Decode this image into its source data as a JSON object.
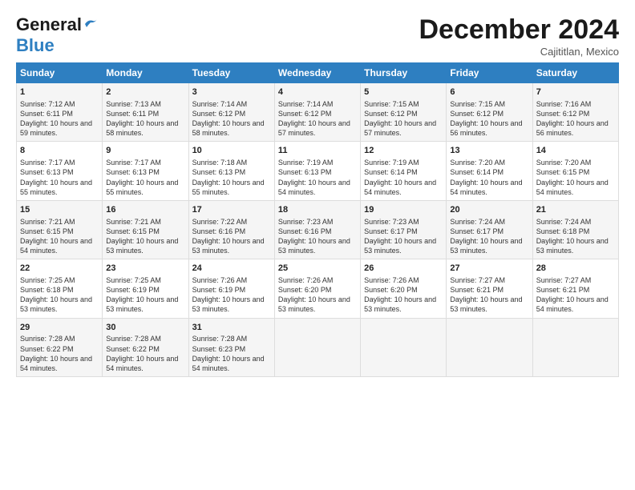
{
  "logo": {
    "part1": "General",
    "part2": "Blue"
  },
  "title": "December 2024",
  "subtitle": "Cajititlan, Mexico",
  "days_of_week": [
    "Sunday",
    "Monday",
    "Tuesday",
    "Wednesday",
    "Thursday",
    "Friday",
    "Saturday"
  ],
  "weeks": [
    [
      {
        "day": "1",
        "sunrise": "7:12 AM",
        "sunset": "6:11 PM",
        "daylight": "10 hours and 59 minutes."
      },
      {
        "day": "2",
        "sunrise": "7:13 AM",
        "sunset": "6:11 PM",
        "daylight": "10 hours and 58 minutes."
      },
      {
        "day": "3",
        "sunrise": "7:14 AM",
        "sunset": "6:12 PM",
        "daylight": "10 hours and 58 minutes."
      },
      {
        "day": "4",
        "sunrise": "7:14 AM",
        "sunset": "6:12 PM",
        "daylight": "10 hours and 57 minutes."
      },
      {
        "day": "5",
        "sunrise": "7:15 AM",
        "sunset": "6:12 PM",
        "daylight": "10 hours and 57 minutes."
      },
      {
        "day": "6",
        "sunrise": "7:15 AM",
        "sunset": "6:12 PM",
        "daylight": "10 hours and 56 minutes."
      },
      {
        "day": "7",
        "sunrise": "7:16 AM",
        "sunset": "6:12 PM",
        "daylight": "10 hours and 56 minutes."
      }
    ],
    [
      {
        "day": "8",
        "sunrise": "7:17 AM",
        "sunset": "6:13 PM",
        "daylight": "10 hours and 55 minutes."
      },
      {
        "day": "9",
        "sunrise": "7:17 AM",
        "sunset": "6:13 PM",
        "daylight": "10 hours and 55 minutes."
      },
      {
        "day": "10",
        "sunrise": "7:18 AM",
        "sunset": "6:13 PM",
        "daylight": "10 hours and 55 minutes."
      },
      {
        "day": "11",
        "sunrise": "7:19 AM",
        "sunset": "6:13 PM",
        "daylight": "10 hours and 54 minutes."
      },
      {
        "day": "12",
        "sunrise": "7:19 AM",
        "sunset": "6:14 PM",
        "daylight": "10 hours and 54 minutes."
      },
      {
        "day": "13",
        "sunrise": "7:20 AM",
        "sunset": "6:14 PM",
        "daylight": "10 hours and 54 minutes."
      },
      {
        "day": "14",
        "sunrise": "7:20 AM",
        "sunset": "6:15 PM",
        "daylight": "10 hours and 54 minutes."
      }
    ],
    [
      {
        "day": "15",
        "sunrise": "7:21 AM",
        "sunset": "6:15 PM",
        "daylight": "10 hours and 54 minutes."
      },
      {
        "day": "16",
        "sunrise": "7:21 AM",
        "sunset": "6:15 PM",
        "daylight": "10 hours and 53 minutes."
      },
      {
        "day": "17",
        "sunrise": "7:22 AM",
        "sunset": "6:16 PM",
        "daylight": "10 hours and 53 minutes."
      },
      {
        "day": "18",
        "sunrise": "7:23 AM",
        "sunset": "6:16 PM",
        "daylight": "10 hours and 53 minutes."
      },
      {
        "day": "19",
        "sunrise": "7:23 AM",
        "sunset": "6:17 PM",
        "daylight": "10 hours and 53 minutes."
      },
      {
        "day": "20",
        "sunrise": "7:24 AM",
        "sunset": "6:17 PM",
        "daylight": "10 hours and 53 minutes."
      },
      {
        "day": "21",
        "sunrise": "7:24 AM",
        "sunset": "6:18 PM",
        "daylight": "10 hours and 53 minutes."
      }
    ],
    [
      {
        "day": "22",
        "sunrise": "7:25 AM",
        "sunset": "6:18 PM",
        "daylight": "10 hours and 53 minutes."
      },
      {
        "day": "23",
        "sunrise": "7:25 AM",
        "sunset": "6:19 PM",
        "daylight": "10 hours and 53 minutes."
      },
      {
        "day": "24",
        "sunrise": "7:26 AM",
        "sunset": "6:19 PM",
        "daylight": "10 hours and 53 minutes."
      },
      {
        "day": "25",
        "sunrise": "7:26 AM",
        "sunset": "6:20 PM",
        "daylight": "10 hours and 53 minutes."
      },
      {
        "day": "26",
        "sunrise": "7:26 AM",
        "sunset": "6:20 PM",
        "daylight": "10 hours and 53 minutes."
      },
      {
        "day": "27",
        "sunrise": "7:27 AM",
        "sunset": "6:21 PM",
        "daylight": "10 hours and 53 minutes."
      },
      {
        "day": "28",
        "sunrise": "7:27 AM",
        "sunset": "6:21 PM",
        "daylight": "10 hours and 54 minutes."
      }
    ],
    [
      {
        "day": "29",
        "sunrise": "7:28 AM",
        "sunset": "6:22 PM",
        "daylight": "10 hours and 54 minutes."
      },
      {
        "day": "30",
        "sunrise": "7:28 AM",
        "sunset": "6:22 PM",
        "daylight": "10 hours and 54 minutes."
      },
      {
        "day": "31",
        "sunrise": "7:28 AM",
        "sunset": "6:23 PM",
        "daylight": "10 hours and 54 minutes."
      },
      null,
      null,
      null,
      null
    ]
  ]
}
